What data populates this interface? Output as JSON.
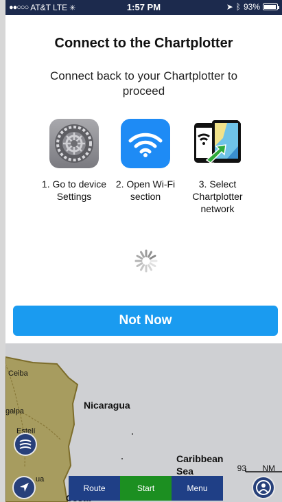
{
  "status": {
    "carrier_dots": "●●○○○",
    "carrier": "AT&T",
    "network": "LTE",
    "time": "1:57 PM",
    "battery": "93%",
    "battery_level": 0.93
  },
  "dialog": {
    "title": "Connect to the Chartplotter",
    "subtitle": "Connect back to your Chartplotter to proceed",
    "steps": [
      {
        "icon": "settings-icon",
        "label": "1. Go to device Settings"
      },
      {
        "icon": "wifi-icon",
        "label": "2. Open Wi-Fi section"
      },
      {
        "icon": "chartplotter-network-icon",
        "label": "3. Select Chartplotter network"
      }
    ],
    "button": "Not Now"
  },
  "map": {
    "labels": {
      "ceiba": "Ceiba",
      "nicaragua": "Nicaragua",
      "galpa": "galpa",
      "esteli": "Estelí",
      "caribbean": "Caribbean",
      "sea": "Sea",
      "managua_partial": "ua",
      "bottom_partial": "Costa"
    },
    "tabs": {
      "route": "Route",
      "start": "Start",
      "menu": "Menu"
    },
    "scale_value": "93",
    "scale_unit": "NM"
  },
  "colors": {
    "accent": "#1a9bf0",
    "status_bar": "#1c2a4d",
    "tab_blue": "#1f3f86",
    "tab_green": "#1c8f21",
    "land": "#a79c5f",
    "water": "#cfd0d3"
  }
}
